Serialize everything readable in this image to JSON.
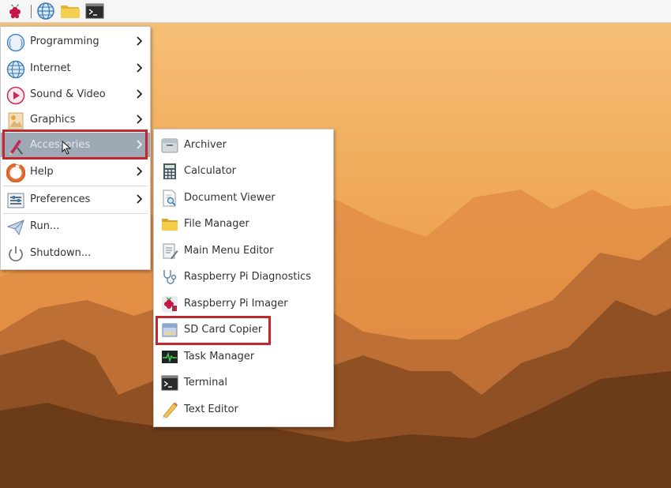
{
  "taskbar": {
    "items": [
      {
        "icon": "raspberry-pi-menu-icon"
      },
      {
        "icon": "web-browser-icon"
      },
      {
        "icon": "file-manager-folder-icon"
      },
      {
        "icon": "terminal-icon"
      }
    ]
  },
  "main_menu": {
    "items": [
      {
        "label": "Programming",
        "icon": "programming-icon",
        "submenu": true
      },
      {
        "label": "Internet",
        "icon": "internet-globe-icon",
        "submenu": true
      },
      {
        "label": "Sound & Video",
        "icon": "sound-video-icon",
        "submenu": true
      },
      {
        "label": "Graphics",
        "icon": "graphics-icon",
        "submenu": true
      },
      {
        "label": "Accessories",
        "icon": "accessories-icon",
        "submenu": true,
        "highlighted": true
      },
      {
        "label": "Help",
        "icon": "help-lifebuoy-icon",
        "submenu": true
      },
      {
        "label": "Preferences",
        "icon": "preferences-icon",
        "submenu": true
      },
      {
        "label": "Run...",
        "icon": "run-paper-plane-icon",
        "submenu": false
      },
      {
        "label": "Shutdown...",
        "icon": "shutdown-power-icon",
        "submenu": false
      }
    ]
  },
  "accessories_menu": {
    "items": [
      {
        "label": "Archiver",
        "icon": "archiver-icon"
      },
      {
        "label": "Calculator",
        "icon": "calculator-icon"
      },
      {
        "label": "Document Viewer",
        "icon": "document-viewer-icon"
      },
      {
        "label": "File Manager",
        "icon": "folder-icon"
      },
      {
        "label": "Main Menu Editor",
        "icon": "menu-editor-icon"
      },
      {
        "label": "Raspberry Pi Diagnostics",
        "icon": "stethoscope-icon"
      },
      {
        "label": "Raspberry Pi Imager",
        "icon": "raspberry-pi-imager-icon"
      },
      {
        "label": "SD Card Copier",
        "icon": "sd-card-icon",
        "highlighted_box": true
      },
      {
        "label": "Task Manager",
        "icon": "task-manager-icon"
      },
      {
        "label": "Terminal",
        "icon": "terminal-icon"
      },
      {
        "label": "Text Editor",
        "icon": "text-editor-pencil-icon"
      }
    ]
  },
  "colors": {
    "highlight": "#9ea9b5",
    "annotation_box": "#c0282d",
    "sky_top": "#f8c67c",
    "sky_bottom": "#e07a2e"
  }
}
